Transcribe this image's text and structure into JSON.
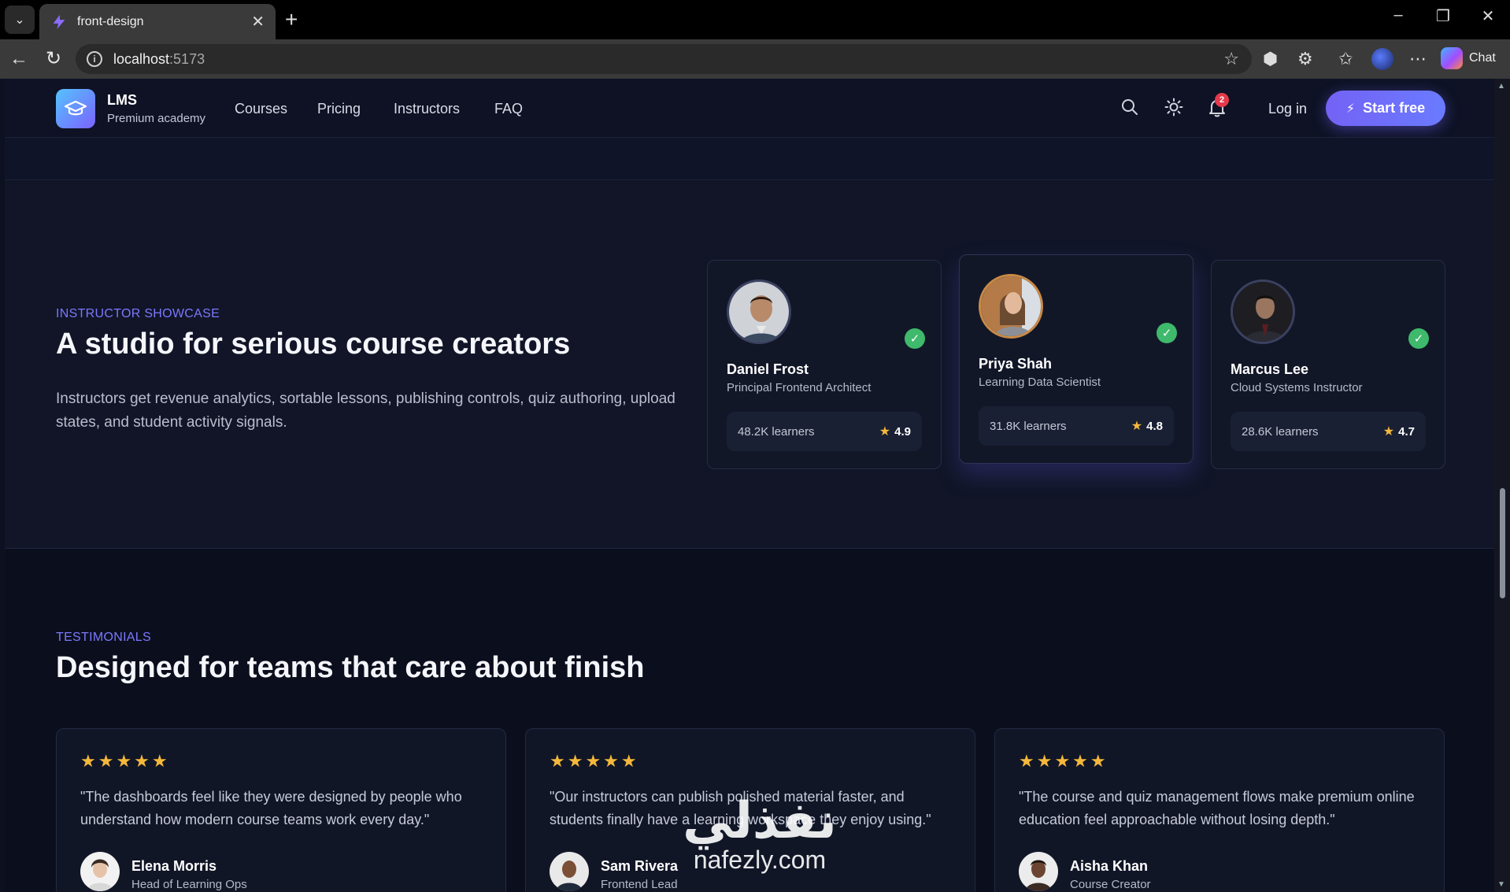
{
  "browser": {
    "tab_title": "front-design",
    "url_host": "localhost",
    "url_port": ":5173",
    "chat_label": "Chat"
  },
  "header": {
    "brand_name": "LMS",
    "brand_sub": "Premium academy",
    "nav": [
      "Courses",
      "Pricing",
      "Instructors",
      "FAQ"
    ],
    "notification_count": "2",
    "login_label": "Log in",
    "cta_label": "Start free"
  },
  "showcase": {
    "eyebrow": "INSTRUCTOR SHOWCASE",
    "title": "A studio for serious course creators",
    "description": "Instructors get revenue analytics, sortable lessons, publishing controls, quiz authoring, upload states, and student activity signals.",
    "instructors": [
      {
        "name": "Daniel Frost",
        "role": "Principal Frontend Architect",
        "learners": "48.2K learners",
        "rating": "4.9"
      },
      {
        "name": "Priya Shah",
        "role": "Learning Data Scientist",
        "learners": "31.8K learners",
        "rating": "4.8"
      },
      {
        "name": "Marcus Lee",
        "role": "Cloud Systems Instructor",
        "learners": "28.6K learners",
        "rating": "4.7"
      }
    ]
  },
  "testimonials": {
    "eyebrow": "TESTIMONIALS",
    "title": "Designed for teams that care about finish",
    "items": [
      {
        "stars": "★★★★★",
        "quote": "\"The dashboards feel like they were designed by people who understand how modern course teams work every day.\"",
        "name": "Elena Morris",
        "role": "Head of Learning Ops"
      },
      {
        "stars": "★★★★★",
        "quote": "\"Our instructors can publish polished material faster, and students finally have a learning workspace they enjoy using.\"",
        "name": "Sam Rivera",
        "role": "Frontend Lead"
      },
      {
        "stars": "★★★★★",
        "quote": "\"The course and quiz management flows make premium online education feel approachable without losing depth.\"",
        "name": "Aisha Khan",
        "role": "Course Creator"
      }
    ]
  },
  "watermark": {
    "arabic": "نفذلي",
    "latin": "nafezly.com"
  },
  "colors": {
    "accent": "#7462f5",
    "eyebrow": "#7b78ff",
    "star": "#f5b83a",
    "verified": "#3fb96b",
    "badge": "#e5394b"
  }
}
